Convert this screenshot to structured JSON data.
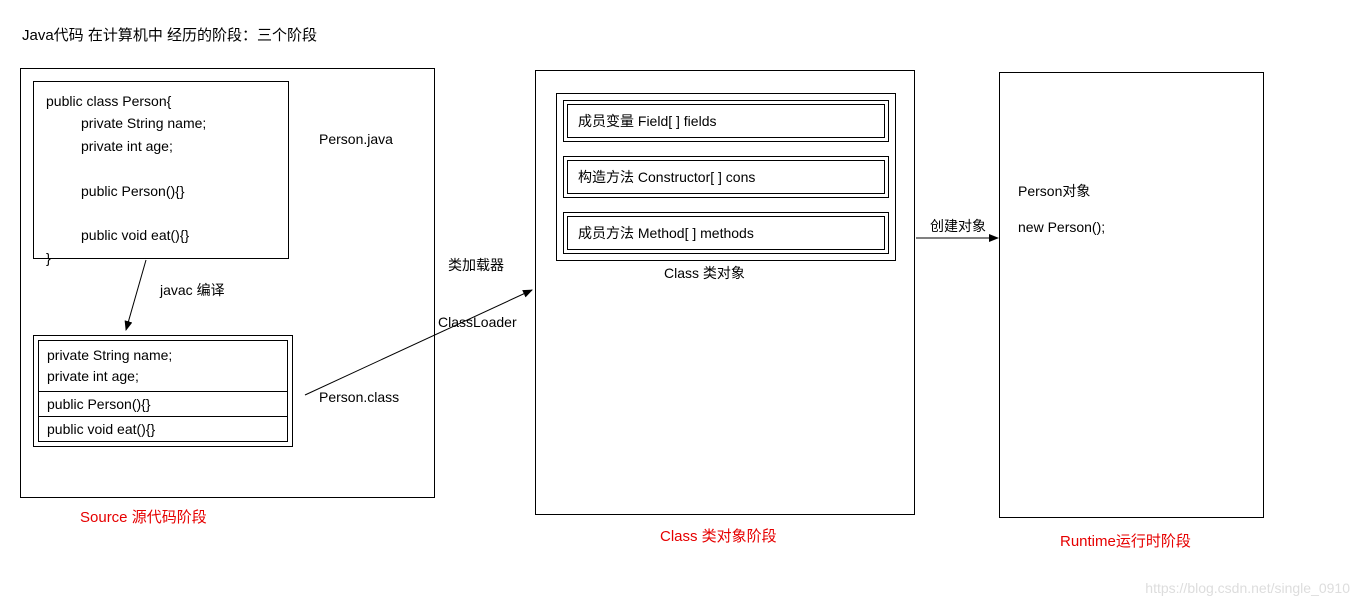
{
  "title": "Java代码 在计算机中 经历的阶段：三个阶段",
  "stage1": {
    "java_file_label": "Person.java",
    "class_file_label": "Person.class",
    "javac_label": "javac 编译",
    "code_text": "public class Person{\n         private String name;\n         private int age;\n\n         public Person(){}\n\n         public void eat(){}\n}",
    "compiled": {
      "fields": "private String name;\nprivate int age;",
      "constructor": "public Person(){}",
      "method": "public void eat(){}"
    },
    "caption": "Source 源代码阶段"
  },
  "arrow1": {
    "top_label": "类加载器",
    "bottom_label": "ClassLoader"
  },
  "stage2": {
    "fields_label": "成员变量  Field[ ] fields",
    "constructors_label": "构造方法  Constructor[ ] cons",
    "methods_label": "成员方法 Method[ ] methods",
    "class_obj_label": "Class 类对象",
    "caption": "Class 类对象阶段"
  },
  "arrow2": {
    "label": "创建对象"
  },
  "stage3": {
    "person_obj_label": "Person对象",
    "new_person_label": "new Person();",
    "caption": "Runtime运行时阶段"
  },
  "watermark": "https://blog.csdn.net/single_0910"
}
